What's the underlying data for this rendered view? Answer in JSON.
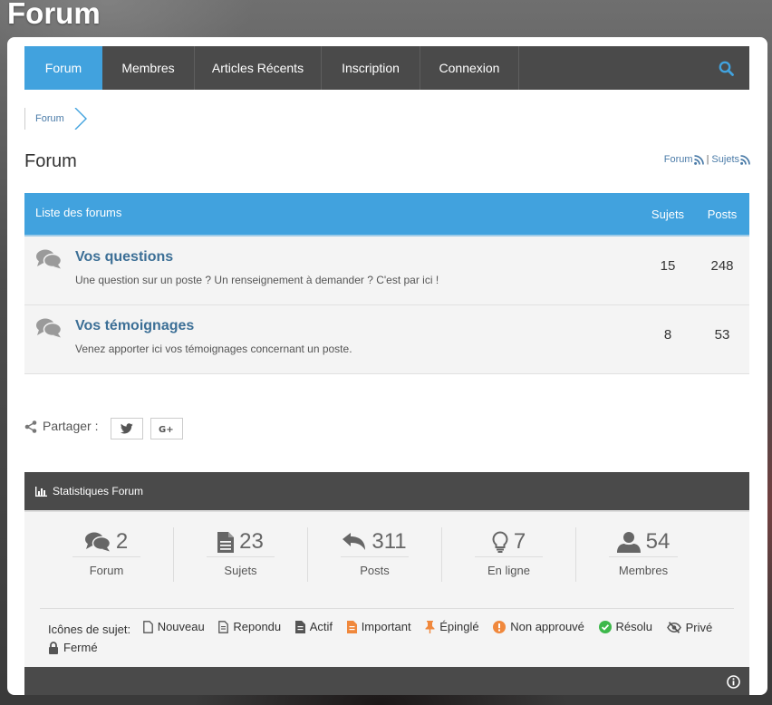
{
  "site": {
    "title": "Forum"
  },
  "nav": {
    "items": [
      {
        "label": "Forum",
        "active": true
      },
      {
        "label": "Membres"
      },
      {
        "label": "Articles Récents"
      },
      {
        "label": "Inscription"
      },
      {
        "label": "Connexion"
      }
    ],
    "search_icon": "search-icon"
  },
  "breadcrumb": {
    "items": [
      "Forum"
    ]
  },
  "page": {
    "title": "Forum",
    "rss_forum": "Forum",
    "rss_separator": "|",
    "rss_topics": "Sujets"
  },
  "forum_table": {
    "header": {
      "title": "Liste des forums",
      "col_topics": "Sujets",
      "col_posts": "Posts"
    },
    "rows": [
      {
        "name": "Vos questions",
        "description": "Une question sur un poste ? Un renseignement à demander ? C'est par ici !",
        "topics": "15",
        "posts": "248"
      },
      {
        "name": "Vos témoignages",
        "description": "Venez apporter ici vos témoignages concernant un poste.",
        "topics": "8",
        "posts": "53"
      }
    ]
  },
  "share": {
    "label": "Partager :"
  },
  "stats": {
    "title": "Statistiques Forum",
    "items": [
      {
        "value": "2",
        "label": "Forum",
        "icon": "comments-icon"
      },
      {
        "value": "23",
        "label": "Sujets",
        "icon": "file-icon"
      },
      {
        "value": "311",
        "label": "Posts",
        "icon": "reply-icon"
      },
      {
        "value": "7",
        "label": "En ligne",
        "icon": "lightbulb-icon"
      },
      {
        "value": "54",
        "label": "Membres",
        "icon": "user-icon"
      }
    ],
    "legend": {
      "title": "Icônes de sujet:",
      "items": [
        {
          "label": "Nouveau",
          "icon": "file-outline-icon",
          "color": "#555555"
        },
        {
          "label": "Repondu",
          "icon": "file-text-outline-icon",
          "color": "#555555"
        },
        {
          "label": "Actif",
          "icon": "file-text-icon",
          "color": "#555555"
        },
        {
          "label": "Important",
          "icon": "file-text-icon",
          "color": "#f0883c"
        },
        {
          "label": "Épinglé",
          "icon": "thumbtack-icon",
          "color": "#f0883c"
        },
        {
          "label": "Non approuvé",
          "icon": "exclamation-circle-icon",
          "color": "#f0883c"
        },
        {
          "label": "Résolu",
          "icon": "check-circle-icon",
          "color": "#3db84b"
        },
        {
          "label": "Privé",
          "icon": "eye-slash-icon",
          "color": "#555555"
        },
        {
          "label": "Fermé",
          "icon": "lock-icon",
          "color": "#555555"
        }
      ]
    }
  },
  "colors": {
    "accent": "#41a2de",
    "nav_bg": "#4a4a4a",
    "link": "#3c6f96"
  }
}
